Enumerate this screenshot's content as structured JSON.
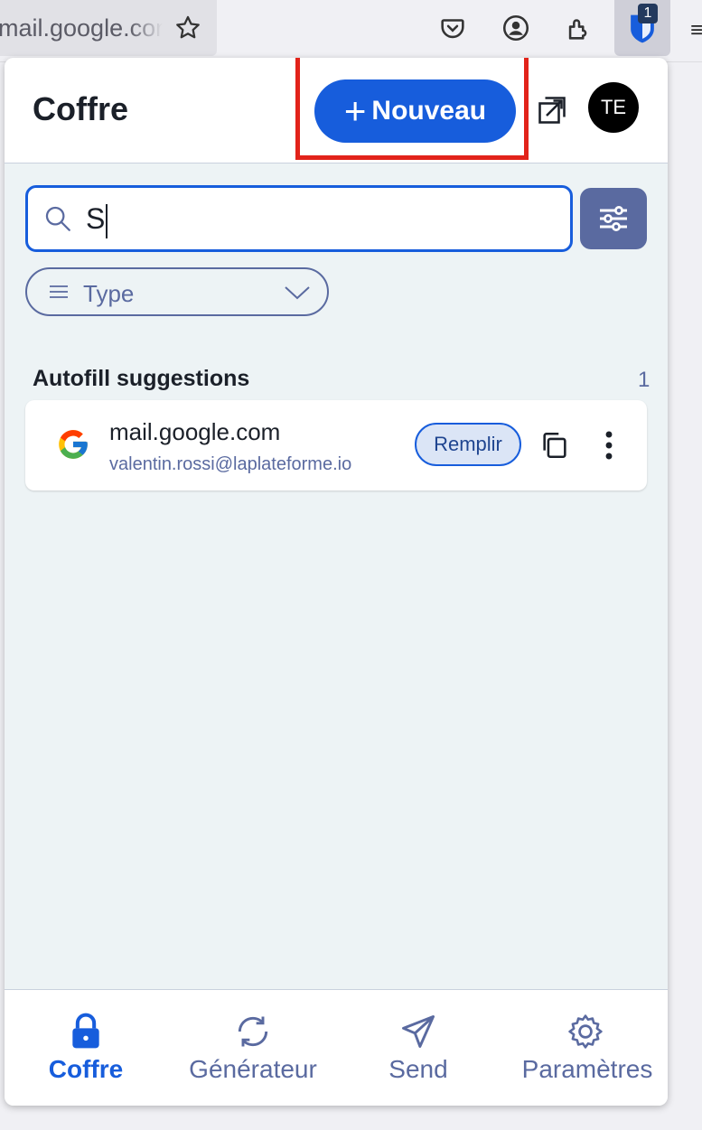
{
  "browser": {
    "url_text": "mail.google.com",
    "extension_badge": "1"
  },
  "popup": {
    "title": "Coffre",
    "new_button_label": "Nouveau",
    "avatar_initials": "TE"
  },
  "search": {
    "value": "S",
    "placeholder": ""
  },
  "type_filter": {
    "label": "Type"
  },
  "autofill": {
    "section_title": "Autofill suggestions",
    "count": "1",
    "items": [
      {
        "title": "mail.google.com",
        "subtitle": "valentin.rossi@laplateforme.io",
        "fill_label": "Remplir"
      }
    ]
  },
  "nav": {
    "items": [
      {
        "label": "Coffre",
        "icon": "lock-icon",
        "active": true
      },
      {
        "label": "Générateur",
        "icon": "refresh-icon",
        "active": false
      },
      {
        "label": "Send",
        "icon": "paper-plane-icon",
        "active": false
      },
      {
        "label": "Paramètres",
        "icon": "gear-icon",
        "active": false
      }
    ]
  },
  "colors": {
    "primary": "#175ddc",
    "muted": "#5a6aa0",
    "highlight": "#e2231a",
    "panel_bg": "#edf3f5"
  }
}
